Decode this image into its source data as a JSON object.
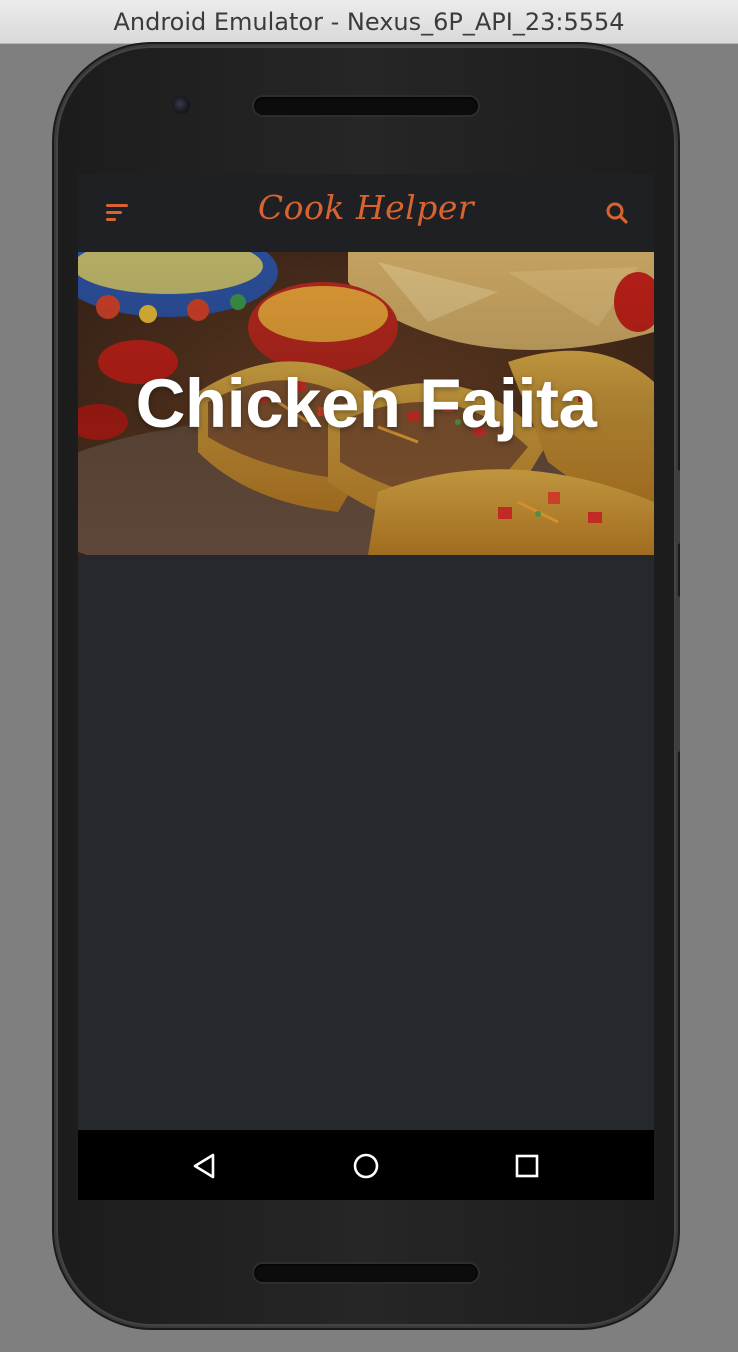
{
  "window": {
    "title": "Android Emulator - Nexus_6P_API_23:5554"
  },
  "app": {
    "title": "Cook Helper",
    "accent_color": "#d9632f",
    "appbar_color": "#1f2024",
    "background_color": "#25282c",
    "menu_icon": "menu-icon",
    "search_icon": "search-icon"
  },
  "hero": {
    "title": "Chicken Fajita",
    "image": "tacos-food-photo"
  },
  "navigation": {
    "back_icon": "back-triangle-icon",
    "home_icon": "home-circle-icon",
    "recents_icon": "recents-square-icon"
  }
}
